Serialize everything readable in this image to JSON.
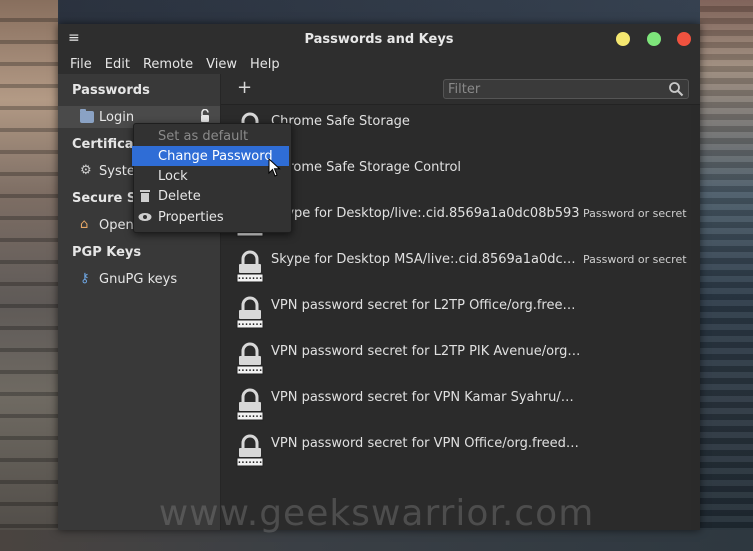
{
  "window": {
    "title": "Passwords and Keys"
  },
  "menubar": [
    "File",
    "Edit",
    "Remote",
    "View",
    "Help"
  ],
  "sidebar": {
    "sections": [
      {
        "heading": "Passwords",
        "items": [
          {
            "label": "Login",
            "icon": "folder-icon",
            "locked_icon": "unlocked-padlock-icon"
          }
        ]
      },
      {
        "heading": "Certificat",
        "items": [
          {
            "label": "Syster",
            "icon": "gear-icon"
          }
        ]
      },
      {
        "heading": "Secure Sh",
        "items": [
          {
            "label": "OpenS",
            "icon": "house-icon"
          }
        ]
      },
      {
        "heading": "PGP Keys",
        "items": [
          {
            "label": "GnuPG keys",
            "icon": "key-icon"
          }
        ]
      }
    ]
  },
  "toolbar": {
    "add_label": "+",
    "filter_placeholder": "Filter"
  },
  "items": [
    {
      "name": "Chrome Safe Storage",
      "type": ""
    },
    {
      "name": "Chrome Safe Storage Control",
      "type": ""
    },
    {
      "name": "Skype for Desktop/live:.cid.8569a1a0dc08b593",
      "type": "Password or secret"
    },
    {
      "name": "Skype for Desktop MSA/live:.cid.8569a1a0dc08b…",
      "type": "Password or secret"
    },
    {
      "name": "VPN password secret for L2TP Office/org.freede…",
      "type": ""
    },
    {
      "name": "VPN password secret for L2TP PIK Avenue/org.fr…",
      "type": ""
    },
    {
      "name": "VPN password secret for VPN Kamar Syahru/org.…",
      "type": ""
    },
    {
      "name": "VPN password secret for VPN Office/org.freedes…",
      "type": ""
    }
  ],
  "context_menu": {
    "items": [
      {
        "label": "Set as default",
        "disabled": true
      },
      {
        "label": "Change Password",
        "highlighted": true
      },
      {
        "label": "Lock"
      },
      {
        "label": "Delete",
        "icon": "trash-icon"
      },
      {
        "label": "Properties",
        "icon": "eye-icon"
      }
    ]
  },
  "watermark": "www.geekswarrior.com",
  "colors": {
    "highlight": "#2f6dd6",
    "min": "#f4e770",
    "max": "#7ee57b",
    "close": "#f0523f"
  }
}
